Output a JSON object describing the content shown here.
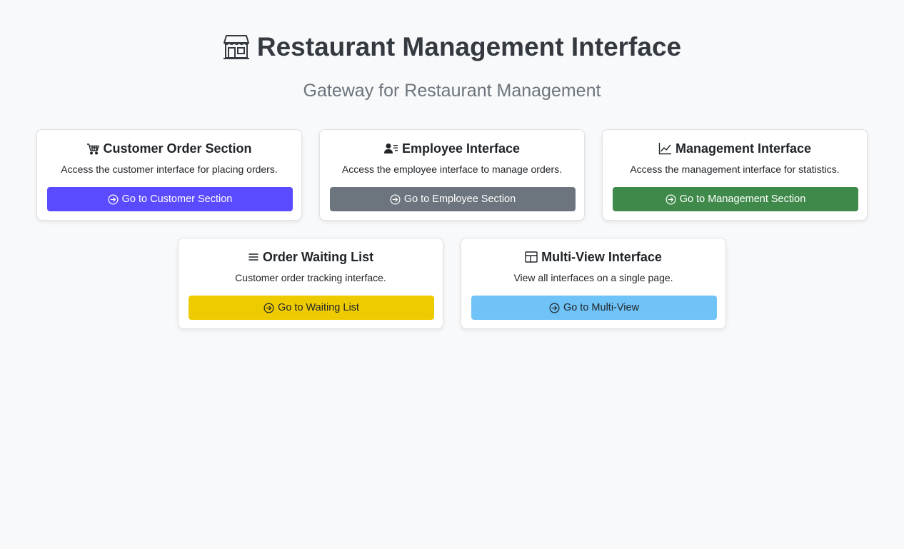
{
  "header": {
    "title": "Restaurant Management Interface",
    "title_icon": "shop-icon",
    "subtitle": "Gateway for Restaurant Management"
  },
  "cards": [
    {
      "title": "Customer Order Section",
      "icon": "cart-icon",
      "description": "Access the customer interface for placing orders.",
      "button_label": "Go to Customer Section",
      "button_color": "#5b4bff"
    },
    {
      "title": "Employee Interface",
      "icon": "person-lines-icon",
      "description": "Access the employee interface to manage orders.",
      "button_label": "Go to Employee Section",
      "button_color": "#6c757d"
    },
    {
      "title": "Management Interface",
      "icon": "graph-up-icon",
      "description": "Access the management interface for statistics.",
      "button_label": "Go to Management Section",
      "button_color": "#3f8a4a"
    },
    {
      "title": "Order Waiting List",
      "icon": "list-icon",
      "description": "Customer order tracking interface.",
      "button_label": "Go to Waiting List",
      "button_color": "#eecb00"
    },
    {
      "title": "Multi-View Interface",
      "icon": "layout-icon",
      "description": "View all interfaces on a single page.",
      "button_label": "Go to Multi-View",
      "button_color": "#6fc3f7"
    }
  ],
  "button_icon": "arrow-right-circle-icon"
}
